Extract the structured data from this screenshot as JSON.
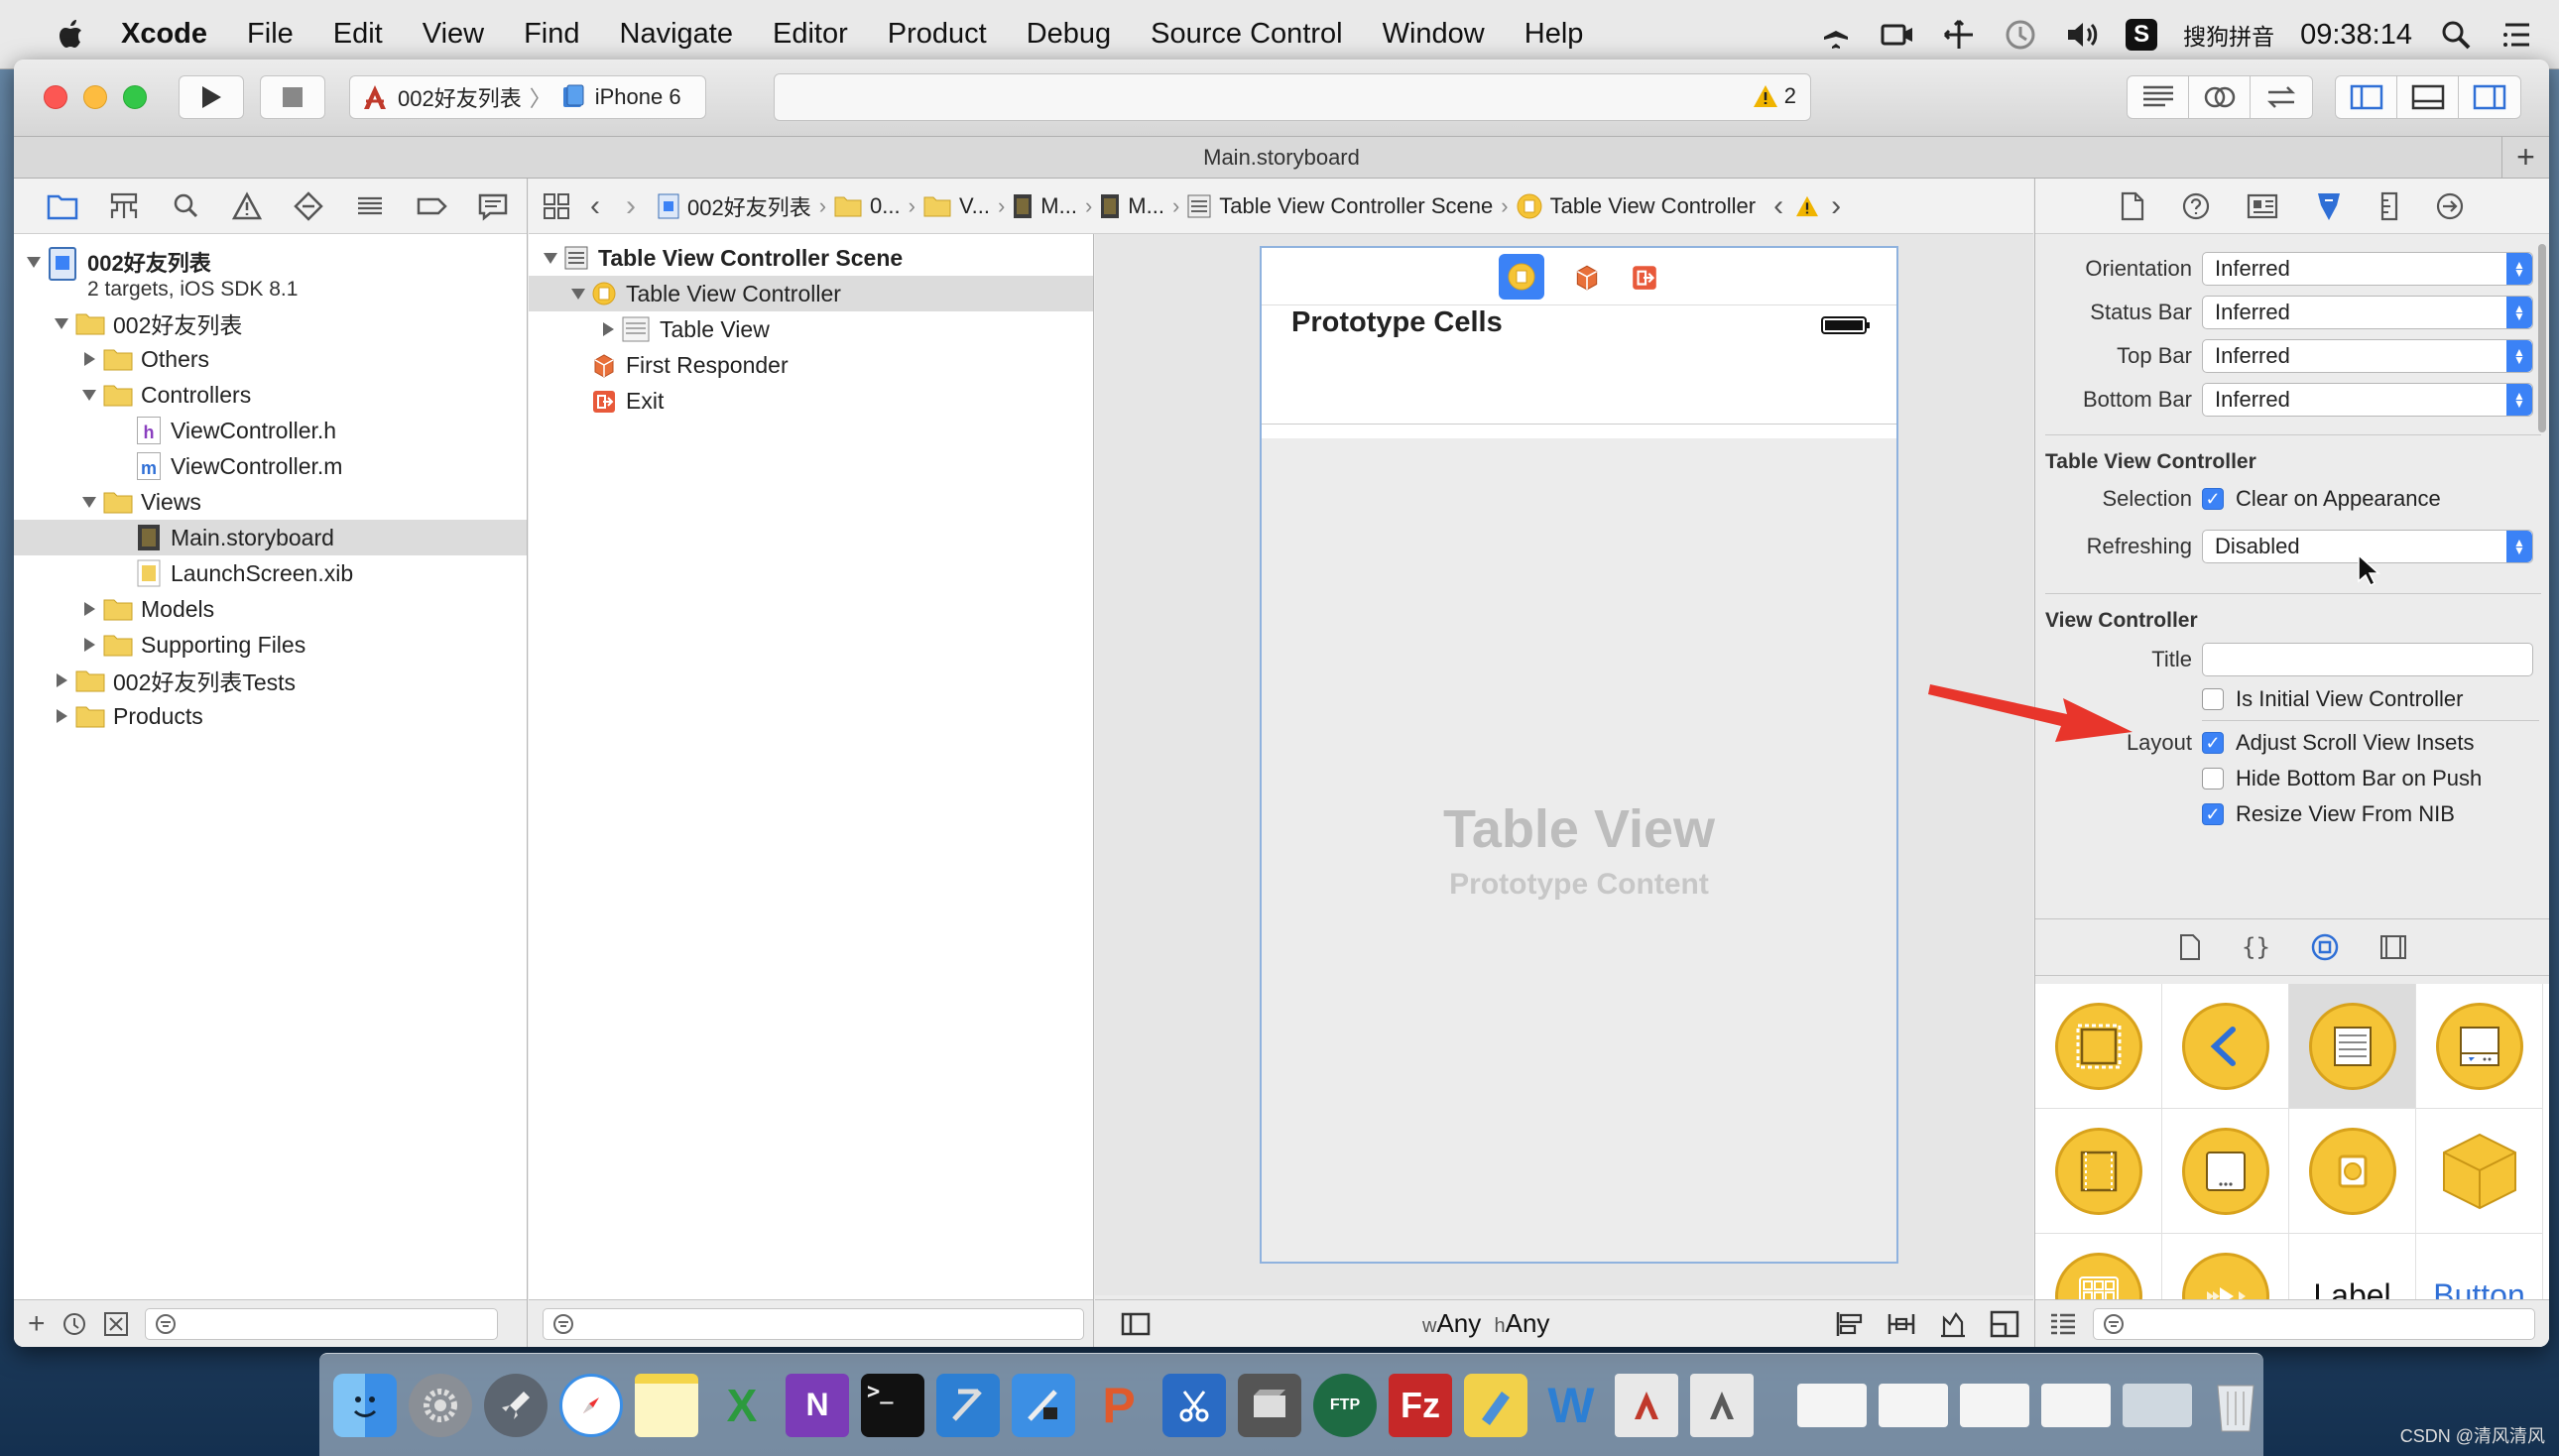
{
  "menubar": {
    "app": "Xcode",
    "items": [
      "File",
      "Edit",
      "View",
      "Find",
      "Navigate",
      "Editor",
      "Product",
      "Debug",
      "Source Control",
      "Window",
      "Help"
    ],
    "input_method": "搜狗拼音",
    "clock": "09:38:14"
  },
  "toolbar": {
    "scheme_project": "002好友列表",
    "scheme_device": "iPhone 6",
    "warning_count": "2"
  },
  "tab": {
    "title": "Main.storyboard"
  },
  "navigator": {
    "project_name": "002好友列表",
    "project_subtitle": "2 targets, iOS SDK 8.1",
    "items": [
      {
        "label": "002好友列表",
        "kind": "group"
      },
      {
        "label": "Others",
        "kind": "group"
      },
      {
        "label": "Controllers",
        "kind": "group"
      },
      {
        "label": "ViewController.h",
        "kind": "file",
        "badge": "h"
      },
      {
        "label": "ViewController.m",
        "kind": "file",
        "badge": "m"
      },
      {
        "label": "Views",
        "kind": "group"
      },
      {
        "label": "Main.storyboard",
        "kind": "file",
        "badge": ""
      },
      {
        "label": "LaunchScreen.xib",
        "kind": "file",
        "badge": ""
      },
      {
        "label": "Models",
        "kind": "group"
      },
      {
        "label": "Supporting Files",
        "kind": "group"
      },
      {
        "label": "002好友列表Tests",
        "kind": "group"
      },
      {
        "label": "Products",
        "kind": "group"
      }
    ]
  },
  "jumpbar": {
    "crumbs": [
      "002好友列表",
      "0...",
      "V...",
      "M...",
      "M...",
      "Table View Controller Scene",
      "Table View Controller"
    ]
  },
  "outline": {
    "scene": "Table View Controller Scene",
    "controller": "Table View Controller",
    "table_view": "Table View",
    "first_responder": "First Responder",
    "exit": "Exit"
  },
  "canvas": {
    "section_header": "Prototype Cells",
    "placeholder_title": "Table View",
    "placeholder_sub": "Prototype Content",
    "size_w": "Any",
    "size_h": "Any",
    "size_w_prefix": "w",
    "size_h_prefix": "h"
  },
  "inspector": {
    "rows": [
      {
        "label": "Orientation",
        "value": "Inferred"
      },
      {
        "label": "Status Bar",
        "value": "Inferred"
      },
      {
        "label": "Top Bar",
        "value": "Inferred"
      },
      {
        "label": "Bottom Bar",
        "value": "Inferred"
      }
    ],
    "tvc_section": "Table View Controller",
    "selection_label": "Selection",
    "selection_value": "Clear on Appearance",
    "refreshing_label": "Refreshing",
    "refreshing_value": "Disabled",
    "vc_section": "View Controller",
    "title_label": "Title",
    "title_value": "",
    "initial_vc": "Is Initial View Controller",
    "layout_label": "Layout",
    "adjust_insets": "Adjust Scroll View Insets",
    "hide_bottom_bar": "Hide Bottom Bar on Push",
    "resize_from_nib": "Resize View From NIB"
  },
  "library": {
    "label_item": "Label",
    "button_item": "Button"
  },
  "annotation": {
    "arrow_color": "#e8352b"
  },
  "colors": {
    "accent": "#3b82f6",
    "library_yellow": "#f5c436"
  },
  "watermark": "CSDN @清风清风"
}
